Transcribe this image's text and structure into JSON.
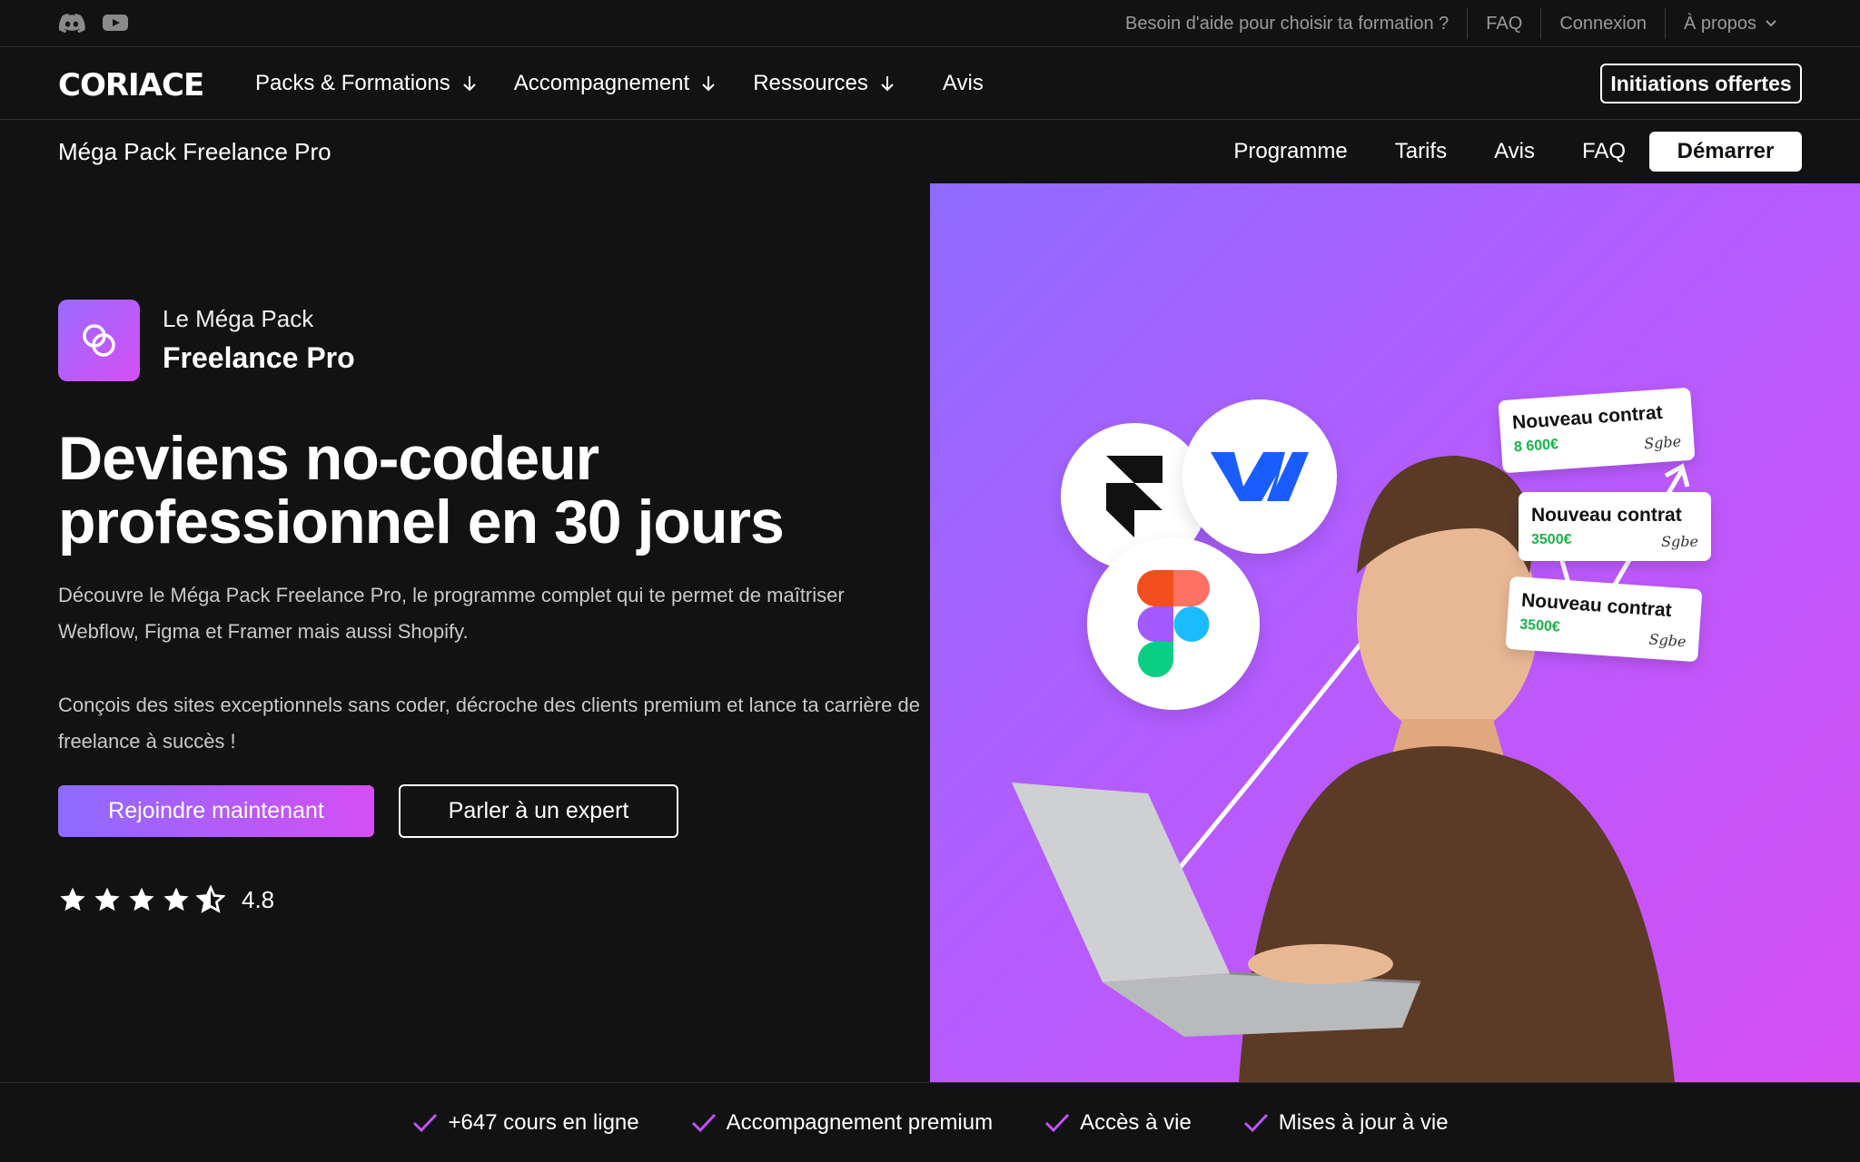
{
  "topbar": {
    "social_icons": [
      "discord-icon",
      "youtube-icon"
    ],
    "links": [
      "Besoin d'aide pour choisir ta formation ?",
      "FAQ",
      "Connexion",
      "À propos"
    ]
  },
  "nav": {
    "logo": "CORIACE",
    "items": [
      "Packs & Formations",
      "Accompagnement",
      "Ressources",
      "Avis"
    ],
    "cta": "Initiations offertes"
  },
  "subnav": {
    "title": "Méga Pack Freelance Pro",
    "links": [
      "Programme",
      "Tarifs",
      "Avis",
      "FAQ"
    ],
    "cta": "Démarrer"
  },
  "hero": {
    "brand_line1": "Le Méga Pack",
    "brand_line2": "Freelance Pro",
    "headline_line1": "Deviens no-codeur",
    "headline_line2": "professionnel en 30 jours",
    "paragraph1": "Découvre le Méga Pack Freelance Pro, le programme complet qui te permet de maîtriser Webflow, Figma et Framer mais aussi Shopify.",
    "paragraph2": "Conçois des sites exceptionnels sans coder, décroche des clients premium et lance ta carrière de freelance à succès !",
    "primary_cta": "Rejoindre maintenant",
    "secondary_cta": "Parler à un expert",
    "rating_value": "4.8",
    "stars": 4.5
  },
  "illustration": {
    "tool_icons": [
      "framer-icon",
      "webflow-icon",
      "figma-icon"
    ],
    "cards": [
      {
        "title": "Nouveau contrat",
        "amount": "8 600€"
      },
      {
        "title": "Nouveau contrat",
        "amount": "3500€"
      },
      {
        "title": "Nouveau contrat",
        "amount": "3500€"
      }
    ]
  },
  "features": [
    "+647 cours en ligne",
    "Accompagnement premium",
    "Accès à vie",
    "Mises à jour à vie"
  ],
  "colors": {
    "background": "#121212",
    "accent_start": "#8d6bff",
    "accent_end": "#d44ff4",
    "check": "#c052f5"
  }
}
